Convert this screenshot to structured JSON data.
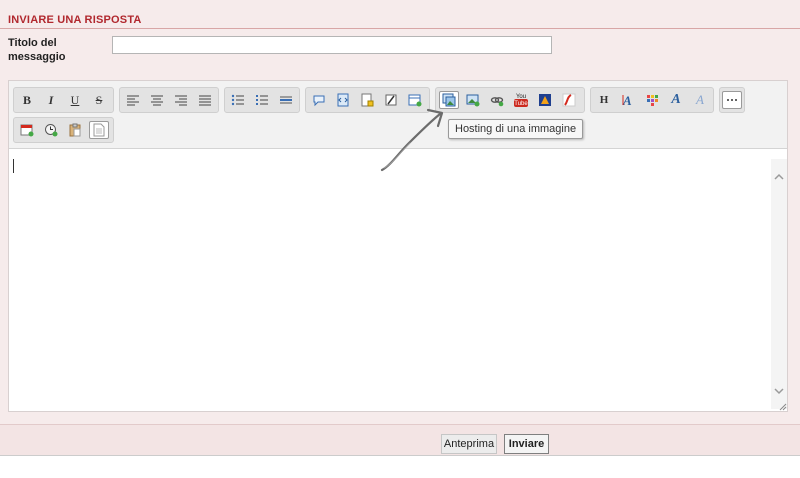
{
  "form": {
    "heading": "INVIARE UNA RISPOSTA",
    "title_label": "Titolo del messaggio",
    "title_value": ""
  },
  "toolbar": {
    "buttons": [
      {
        "name": "bold-button",
        "label": "B"
      },
      {
        "name": "italic-button",
        "label": "I"
      },
      {
        "name": "underline-button",
        "label": "U"
      },
      {
        "name": "strikethrough-button",
        "label": "S"
      },
      {
        "name": "align-left-button",
        "icon": "align-left-icon"
      },
      {
        "name": "align-center-button",
        "icon": "align-center-icon"
      },
      {
        "name": "align-right-button",
        "icon": "align-right-icon"
      },
      {
        "name": "align-justify-button",
        "icon": "align-justify-icon"
      },
      {
        "name": "bullet-list-button",
        "icon": "bullet-list-icon"
      },
      {
        "name": "numbered-list-button",
        "icon": "numbered-list-icon"
      },
      {
        "name": "horizontal-rule-button",
        "icon": "horizontal-rule-icon"
      },
      {
        "name": "quote-button",
        "icon": "speech-bubble-icon"
      },
      {
        "name": "code-button",
        "icon": "code-icon"
      },
      {
        "name": "spoiler-button",
        "icon": "note-icon"
      },
      {
        "name": "hide-button",
        "icon": "slash-icon"
      },
      {
        "name": "table-button",
        "icon": "table-icon"
      },
      {
        "name": "image-hosting-button",
        "icon": "image-upload-icon"
      },
      {
        "name": "image-button",
        "icon": "image-icon"
      },
      {
        "name": "link-button",
        "icon": "link-icon"
      },
      {
        "name": "youtube-button",
        "icon": "youtube-icon",
        "label": "You Tube"
      },
      {
        "name": "dailymotion-button",
        "icon": "video-icon"
      },
      {
        "name": "flash-button",
        "icon": "flash-icon"
      },
      {
        "name": "heading-button",
        "label": "H"
      },
      {
        "name": "font-size-button",
        "icon": "font-size-icon"
      },
      {
        "name": "color-button",
        "icon": "color-palette-icon"
      },
      {
        "name": "font-face-button",
        "icon": "font-face-icon",
        "label": "A"
      },
      {
        "name": "remove-format-button",
        "icon": "remove-format-icon",
        "label": "A"
      },
      {
        "name": "more-button",
        "icon": "more-icon"
      },
      {
        "name": "date-button",
        "icon": "calendar-icon"
      },
      {
        "name": "time-button",
        "icon": "clock-icon"
      },
      {
        "name": "paste-button",
        "icon": "clipboard-icon"
      },
      {
        "name": "source-button",
        "icon": "document-icon"
      }
    ],
    "tooltip": "Hosting di una immagine"
  },
  "editor": {
    "content": ""
  },
  "actions": {
    "preview_label": "Anteprima",
    "send_label": "Inviare"
  },
  "colors": {
    "accent": "#b1282e",
    "panel_bg": "#f6ebeb",
    "toolbar_bg": "#f2f2f2"
  }
}
